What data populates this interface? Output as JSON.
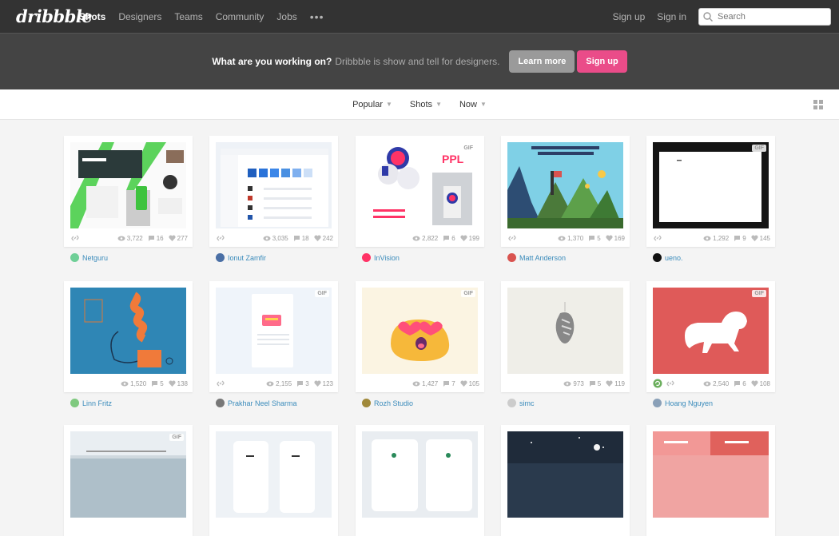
{
  "nav": {
    "logo": "dribbble",
    "links": [
      "Shots",
      "Designers",
      "Teams",
      "Community",
      "Jobs"
    ],
    "more": "•••",
    "signup": "Sign up",
    "signin": "Sign in",
    "search_placeholder": "Search"
  },
  "banner": {
    "question": "What are you working on?",
    "subtitle": "Dribbble is show and tell for designers.",
    "learn_more": "Learn more",
    "sign_up": "Sign up"
  },
  "filters": {
    "popular": "Popular",
    "shots": "Shots",
    "now": "Now"
  },
  "shots": [
    {
      "views": "3,722",
      "comments": "16",
      "likes": "277",
      "author": "Netguru",
      "gif": "",
      "avatar_color": "#6fcf97"
    },
    {
      "views": "3,035",
      "comments": "18",
      "likes": "242",
      "author": "Ionut Zamfir",
      "gif": "",
      "avatar_color": "#4a6fa5"
    },
    {
      "views": "2,822",
      "comments": "6",
      "likes": "199",
      "author": "InVision",
      "gif": "GIF",
      "avatar_color": "#ff3366"
    },
    {
      "views": "1,370",
      "comments": "5",
      "likes": "169",
      "author": "Matt Anderson",
      "gif": "",
      "avatar_color": "#d9534f"
    },
    {
      "views": "1,292",
      "comments": "9",
      "likes": "145",
      "author": "ueno.",
      "gif": "GIF",
      "avatar_color": "#111111"
    },
    {
      "views": "1,520",
      "comments": "5",
      "likes": "138",
      "author": "Linn Fritz",
      "gif": "",
      "avatar_color": "#7fc97f"
    },
    {
      "views": "2,155",
      "comments": "3",
      "likes": "123",
      "author": "Prakhar Neel Sharma",
      "gif": "GIF",
      "avatar_color": "#777777"
    },
    {
      "views": "1,427",
      "comments": "7",
      "likes": "105",
      "author": "Rozh Studio",
      "gif": "GIF",
      "avatar_color": "#a0893a"
    },
    {
      "views": "973",
      "comments": "5",
      "likes": "119",
      "author": "simc",
      "gif": "",
      "avatar_color": "#cccccc"
    },
    {
      "views": "2,540",
      "comments": "6",
      "likes": "108",
      "author": "Hoang Nguyen",
      "gif": "GIF",
      "avatar_color": "#8aa0b8"
    },
    {
      "gif": "GIF"
    },
    {
      "gif": ""
    },
    {
      "gif": ""
    },
    {
      "gif": ""
    },
    {
      "gif": ""
    }
  ]
}
